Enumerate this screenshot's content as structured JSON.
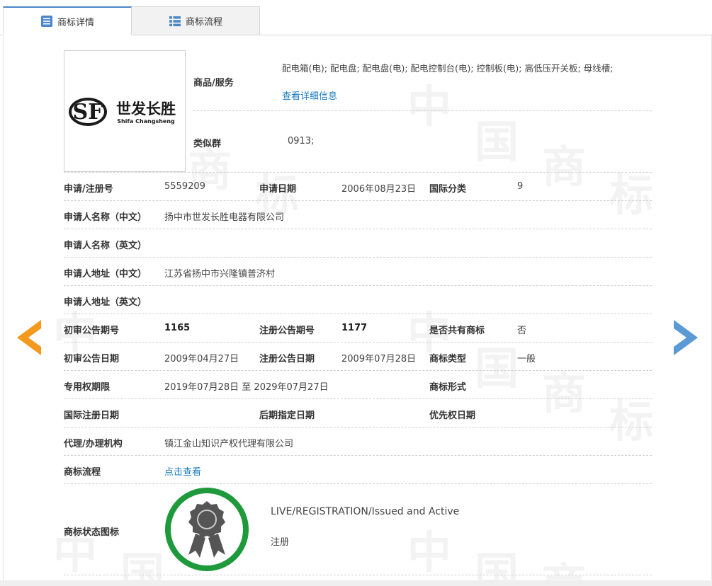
{
  "tabs": [
    {
      "label": "商标详情",
      "icon": "list-icon",
      "active": true
    },
    {
      "label": "商标流程",
      "icon": "grid-list-icon",
      "active": false
    }
  ],
  "logo": {
    "mark": "SF",
    "chinese": "世发长胜",
    "english": "Shifa Changsheng"
  },
  "goods": {
    "label": "商品/服务",
    "value": "配电箱(电); 配电盘; 配电盘(电); 配电控制台(电); 控制板(电); 高低压开关板; 母线槽;",
    "detail_link": "查看详细信息"
  },
  "similar": {
    "label": "类似群",
    "value": "0913;"
  },
  "fields": {
    "reg_no_label": "申请/注册号",
    "reg_no": "5559209",
    "apply_date_label": "申请日期",
    "apply_date": "2006年08月23日",
    "intl_class_label": "国际分类",
    "intl_class": "9",
    "applicant_cn_label": "申请人名称（中文）",
    "applicant_cn": "扬中市世发长胜电器有限公司",
    "applicant_en_label": "申请人名称（英文）",
    "applicant_en": "",
    "address_cn_label": "申请人地址（中文）",
    "address_cn": "江苏省扬中市兴隆镇普济村",
    "address_en_label": "申请人地址（英文）",
    "address_en": "",
    "prelim_issue_label": "初审公告期号",
    "prelim_issue": "1165",
    "reg_issue_label": "注册公告期号",
    "reg_issue": "1177",
    "shared_label": "是否共有商标",
    "shared": "否",
    "prelim_date_label": "初审公告日期",
    "prelim_date": "2009年04月27日",
    "reg_date_label": "注册公告日期",
    "reg_date": "2009年07月28日",
    "type_label": "商标类型",
    "type": "一般",
    "term_label": "专用权期限",
    "term": "2019年07月28日 至 2029年07月27日",
    "form_label": "商标形式",
    "form": "",
    "intl_reg_date_label": "国际注册日期",
    "intl_reg_date": "",
    "later_date_label": "后期指定日期",
    "later_date": "",
    "priority_date_label": "优先权日期",
    "priority_date": "",
    "agent_label": "代理/办理机构",
    "agent": "镇江金山知识产权代理有限公司",
    "process_label": "商标流程",
    "process_link": "点击查看",
    "status_icon_label": "商标状态图标",
    "status_en": "LIVE/REGISTRATION/Issued and Active",
    "status_cn": "注册"
  },
  "watermark_chars": [
    "中",
    "国",
    "商",
    "标"
  ],
  "colors": {
    "accent_blue": "#1a7cc2",
    "arrow_left": "#f39a1e",
    "arrow_right": "#5b9bd5",
    "status_ring": "#1e9a3c",
    "badge_dark": "#555555"
  },
  "nav": {
    "prev_icon": "chevron-left-icon",
    "next_icon": "chevron-right-icon"
  }
}
